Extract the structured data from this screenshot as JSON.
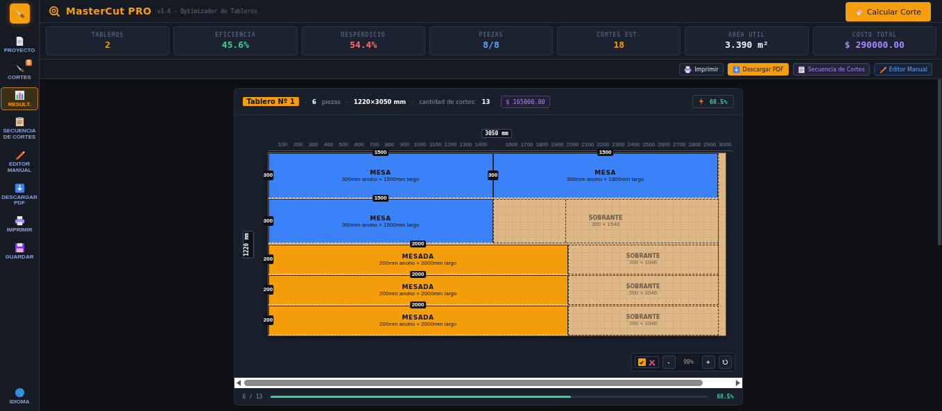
{
  "app": {
    "title": "MasterCut PRO",
    "subtitle": "v3.4 - Optimizador de Tableros",
    "action": "Calcular Corte"
  },
  "sidebar": {
    "items": [
      {
        "label": "PROYECTO",
        "selected": false
      },
      {
        "label": "CORTES",
        "selected": false,
        "badge": "8"
      },
      {
        "label": "RESULT.",
        "selected": true
      },
      {
        "label": "SECUENCIA DE CORTES",
        "selected": false
      },
      {
        "label": "EDITOR MANUAL",
        "selected": false
      },
      {
        "label": "DESCARGAR PDF",
        "selected": false
      },
      {
        "label": "IMPRIMIR",
        "selected": false
      },
      {
        "label": "GUARDAR",
        "selected": false
      }
    ],
    "footer_item": {
      "label": "IDIOMA"
    }
  },
  "stats": [
    {
      "label": "TABLEROS",
      "value": "2",
      "color": "#f59e0b"
    },
    {
      "label": "EFICIENCIA",
      "value": "45.6%",
      "color": "#34d399"
    },
    {
      "label": "DESPERDICIO",
      "value": "54.4%",
      "color": "#f87171"
    },
    {
      "label": "PIEZAS",
      "value": "8/8",
      "color": "#60a5fa"
    },
    {
      "label": "CORTES EST.",
      "value": "18",
      "color": "#f59e0b"
    },
    {
      "label": "AREA UTIL",
      "value": "3.390 m²",
      "color": "#f1f5f9"
    },
    {
      "label": "COSTO TOTAL",
      "value": "$ 290000.00",
      "color": "#a78bfa"
    }
  ],
  "toolbar": [
    {
      "label": "Imprimir",
      "kind": "print"
    },
    {
      "label": "Descargar PDF",
      "kind": "download"
    },
    {
      "label": "Secuencia de Cortes",
      "kind": "sequence"
    },
    {
      "label": "Editor Manual",
      "kind": "editor"
    }
  ],
  "board": {
    "header": [
      {
        "kind": "title",
        "text": "Tablero Nº 1"
      },
      {
        "kind": "sep",
        "text": "-"
      },
      {
        "kind": "strong",
        "text": "6"
      },
      {
        "kind": "muted",
        "text": "piezas"
      },
      {
        "kind": "sep",
        "text": "-"
      },
      {
        "kind": "strong",
        "text": "1220×3050 mm"
      },
      {
        "kind": "sep",
        "text": "-"
      },
      {
        "kind": "muted",
        "text": "cantidad de cortes:"
      },
      {
        "kind": "strong",
        "text": "13"
      },
      {
        "kind": "cost",
        "text": "$ 165000.00"
      }
    ],
    "efficiency": "68.5%",
    "ruler": {
      "ticks": [
        "100",
        "200",
        "300",
        "400",
        "500",
        "600",
        "700",
        "800",
        "900",
        "1000",
        "1100",
        "1200",
        "1300",
        "1400",
        "1600",
        "1700",
        "1800",
        "1900",
        "2000",
        "2100",
        "2200",
        "2300",
        "2400",
        "2500",
        "2600",
        "2700",
        "2800",
        "2900",
        "3000"
      ],
      "length_label": "3050 mm",
      "height_label": "1220 mm"
    },
    "rows": [
      {
        "pieces": [
          {
            "kind": "piece",
            "name": "MESA",
            "dims": "300mm anoho × 1500mm largo",
            "width_label": "1500",
            "height_label": "300",
            "color": "#3b82f6"
          },
          {
            "kind": "piece",
            "name": "MESA",
            "dims": "300mm anoho × 1500mm largo",
            "width_label": "1500",
            "height_label": "300",
            "color": "#3b82f6"
          }
        ]
      },
      {
        "pieces": [
          {
            "kind": "piece",
            "name": "MESA",
            "dims": "300mm anoho × 1500mm largo",
            "width_label": "1500",
            "height_label": "300",
            "color": "#3b82f6"
          },
          {
            "kind": "leftover",
            "name": "SOBRANTE",
            "dims": "300 × 1546"
          }
        ]
      },
      {
        "pieces": [
          {
            "kind": "piece",
            "name": "MESADA",
            "dims": "200mm anoho × 2000mm largo",
            "width_label": "2000",
            "height_label": "200",
            "color": "#f59e0b"
          },
          {
            "kind": "leftover",
            "name": "SOBRANTE",
            "dims": "200 × 1046"
          }
        ]
      },
      {
        "pieces": [
          {
            "kind": "piece",
            "name": "MESADA",
            "dims": "200mm anoho × 2000mm largo",
            "width_label": "2000",
            "height_label": "200",
            "color": "#f59e0b"
          },
          {
            "kind": "leftover",
            "name": "SOBRANTE",
            "dims": "200 × 1046"
          }
        ]
      },
      {
        "pieces": [
          {
            "kind": "piece",
            "name": "MESADA",
            "dims": "200mm anoho × 2000mm largo",
            "width_label": "2000",
            "height_label": "200",
            "color": "#f59e0b"
          },
          {
            "kind": "leftover",
            "name": "SOBRANTE",
            "dims": "200 × 1046"
          }
        ]
      }
    ],
    "zoom": {
      "show_cuts": true,
      "minus": "-",
      "level_text": "90%",
      "plus": "+"
    },
    "progress": {
      "count": "6 / 13",
      "level": 0.685,
      "percent": "68.5%"
    }
  }
}
